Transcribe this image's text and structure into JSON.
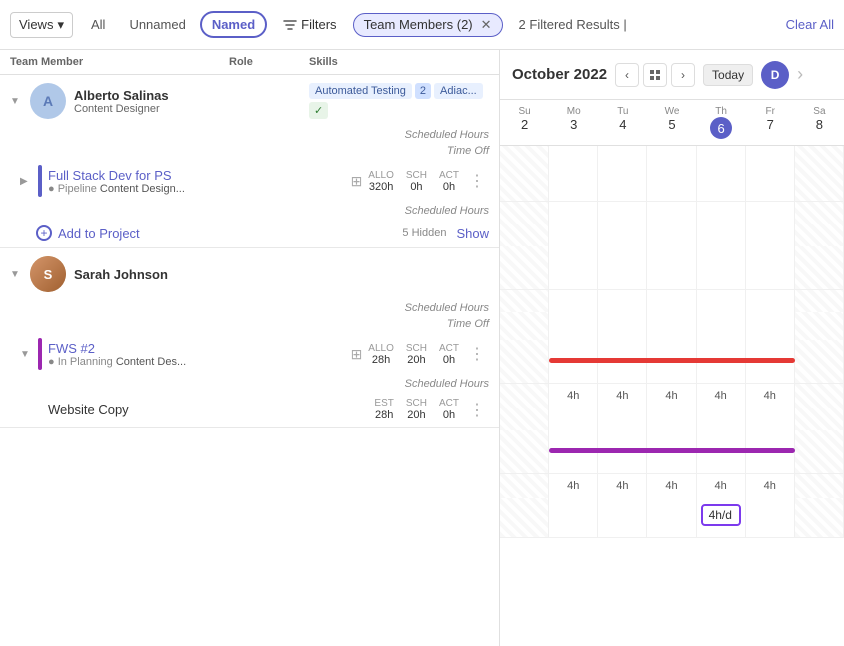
{
  "toolbar": {
    "views_label": "Views",
    "all_label": "All",
    "unnamed_label": "Unnamed",
    "named_label": "Named",
    "filters_label": "Filters",
    "team_members_chip": "Team Members (2)",
    "results_text": "2 Filtered Results",
    "divider": "|",
    "clear_all_label": "Clear All"
  },
  "columns": {
    "team_member": "Team Member",
    "role": "Role",
    "skills": "Skills"
  },
  "people": [
    {
      "id": "alberto",
      "name": "Alberto Salinas",
      "role": "Content Designer",
      "avatar_initials": "AS",
      "avatar_color": "#b0c8e8",
      "skills": [
        "Automated Testing",
        "2",
        "Adiac...",
        "✓"
      ],
      "scheduled_hours_label": "Scheduled Hours",
      "time_off_label": "Time Off",
      "projects": [
        {
          "name": "Full Stack Dev for PS",
          "status": "Pipeline",
          "role": "Content Design...",
          "color": "#5b5fc7",
          "allo_label": "ALLO",
          "allo_val": "320h",
          "sch_label": "SCH",
          "sch_val": "0h",
          "act_label": "ACT",
          "act_val": "0h"
        }
      ],
      "hidden_count": "5 Hidden",
      "show_label": "Show",
      "add_project_label": "Add to Project"
    },
    {
      "id": "sarah",
      "name": "Sarah Johnson",
      "role": "",
      "avatar_initials": "SJ",
      "avatar_img": true,
      "avatar_color": "#c8a080",
      "scheduled_hours_label": "Scheduled Hours",
      "time_off_label": "Time Off",
      "projects": [
        {
          "name": "FWS #2",
          "status": "In Planning",
          "role": "Content Des...",
          "color": "#9c27b0",
          "allo_label": "ALLO",
          "allo_val": "28h",
          "sch_label": "SCH",
          "sch_val": "20h",
          "act_label": "ACT",
          "act_val": "0h"
        },
        {
          "name": "Website Copy",
          "status": "",
          "role": "",
          "color": "",
          "est_label": "EST",
          "est_val": "28h",
          "sch_label": "SCH",
          "sch_val": "20h",
          "act_label": "ACT",
          "act_val": "0h"
        }
      ]
    }
  ],
  "calendar": {
    "month": "October 2022",
    "today_label": "Today",
    "avatar_letter": "D",
    "days": [
      {
        "name": "Su",
        "num": "2",
        "today": false,
        "weekend": true
      },
      {
        "name": "Mo",
        "num": "3",
        "today": false,
        "weekend": false
      },
      {
        "name": "Tu",
        "num": "4",
        "today": false,
        "weekend": false
      },
      {
        "name": "We",
        "num": "5",
        "today": false,
        "weekend": false
      },
      {
        "name": "Th",
        "num": "6",
        "today": true,
        "weekend": false
      },
      {
        "name": "Fr",
        "num": "7",
        "today": false,
        "weekend": false
      },
      {
        "name": "Sa",
        "num": "8",
        "today": false,
        "weekend": true
      }
    ],
    "sarah_hours": [
      "4h",
      "4h",
      "4h",
      "4h",
      "4h"
    ],
    "sarah_bar_color": "#e53935",
    "fws_hours": [
      "4h",
      "4h",
      "4h",
      "4h",
      "4h"
    ],
    "fws_bar_color": "#9c27b0",
    "website_copy_input": "4h/d",
    "website_copy_bar_color": "#7c3aed"
  }
}
